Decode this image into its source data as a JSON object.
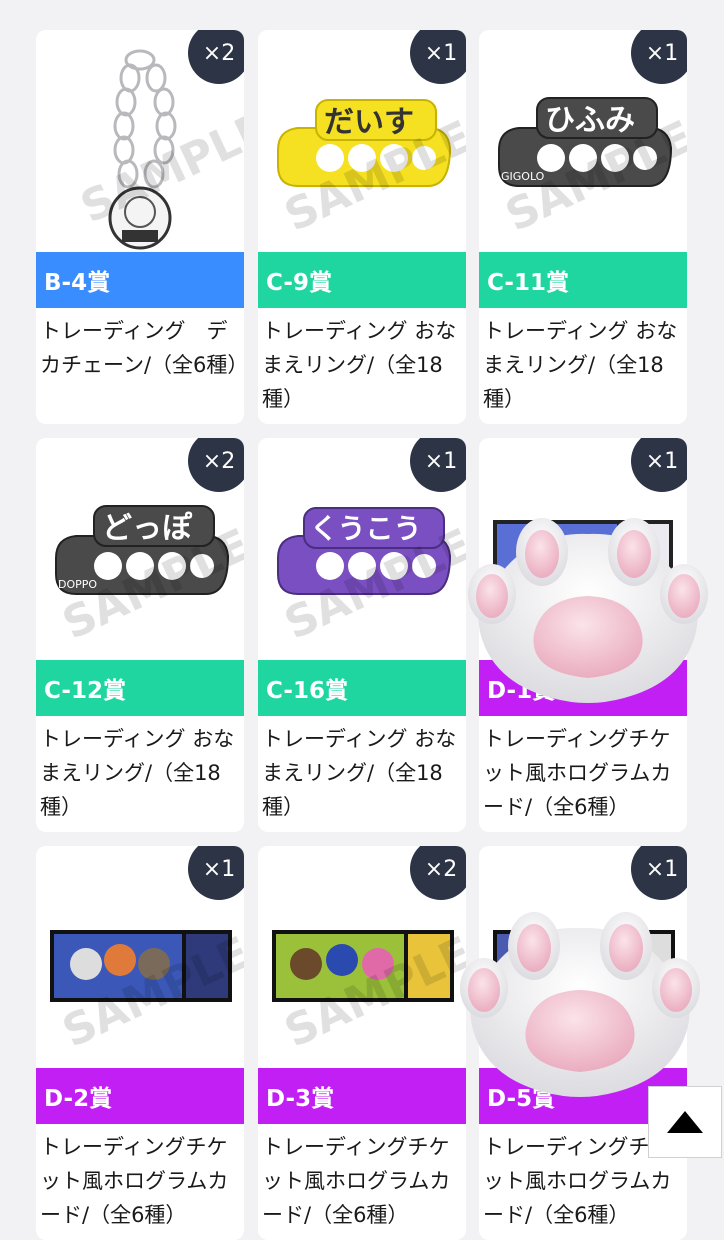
{
  "colors": {
    "blue": "#3a8dff",
    "green": "#1fd6a0",
    "purple": "#c21ff5",
    "badge": "#2c3446"
  },
  "watermark": "SAMPLE",
  "cards": [
    {
      "qty": "×2",
      "prize": "B-4賞",
      "title": "トレーディング　デカチェーン/（全6種）",
      "color": "blue",
      "art": "chain"
    },
    {
      "qty": "×1",
      "prize": "C-9賞",
      "title": "トレーディング おなまえリング/（全18種）",
      "color": "green",
      "art": "ring-yellow",
      "ring_text": "だいす"
    },
    {
      "qty": "×1",
      "prize": "C-11賞",
      "title": "トレーディング おなまえリング/（全18種）",
      "color": "green",
      "art": "ring-dark",
      "ring_text": "ひふみ",
      "ring_tag": "GIGOLO"
    },
    {
      "qty": "×2",
      "prize": "C-12賞",
      "title": "トレーディング おなまえリング/（全18種）",
      "color": "green",
      "art": "ring-dark",
      "ring_text": "どっぽ",
      "ring_tag": "DOPPO"
    },
    {
      "qty": "×1",
      "prize": "C-16賞",
      "title": "トレーディング おなまえリング/（全18種）",
      "color": "green",
      "art": "ring-purple",
      "ring_text": "くうこう"
    },
    {
      "qty": "×1",
      "prize": "D-1賞",
      "title": "トレーディングチケット風ホログラムカード/（全6種）",
      "color": "purple",
      "art": "ticket"
    },
    {
      "qty": "×1",
      "prize": "D-2賞",
      "title": "トレーディングチケット風ホログラムカード/（全6種）",
      "color": "purple",
      "art": "ticket"
    },
    {
      "qty": "×2",
      "prize": "D-3賞",
      "title": "トレーディングチケット風ホログラムカード/（全6種）",
      "color": "purple",
      "art": "ticket"
    },
    {
      "qty": "×1",
      "prize": "D-5賞",
      "title": "トレーディングチケット風ホログラムカード/（全6種）",
      "color": "purple",
      "art": "ticket"
    }
  ]
}
